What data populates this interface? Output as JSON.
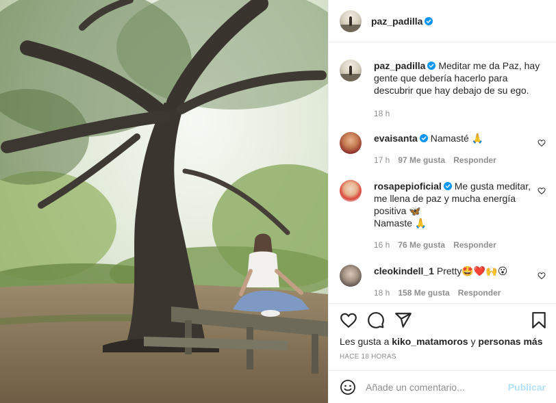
{
  "post": {
    "author": "paz_padilla",
    "caption": "Meditar me da Paz, hay gente que debería hacerlo para descubrir que hay debajo de su ego.",
    "caption_time": "18 h"
  },
  "comments": [
    {
      "user": "evaisanta",
      "verified": true,
      "text": "Namasté 🙏",
      "time": "17 h",
      "likes": "97 Me gusta",
      "reply": "Responder"
    },
    {
      "user": "rosapepioficial",
      "verified": true,
      "text": "Me gusta meditar, me llena de paz y mucha energía positiva 🦋",
      "text2": "Namaste 🙏",
      "time": "16 h",
      "likes": "76 Me gusta",
      "reply": "Responder"
    },
    {
      "user": "cleokindell_1",
      "verified": false,
      "text": "Pretty🤩❤️🙌😮",
      "time": "18 h",
      "likes": "158 Me gusta",
      "reply": "Responder"
    }
  ],
  "likes_line": {
    "prefix": "Les gusta a",
    "user": "kiko_matamoros",
    "connector": "y",
    "others": "personas más"
  },
  "posted": "HACE 18 HORAS",
  "comment_box": {
    "placeholder": "Añade un comentario...",
    "button": "Publicar"
  },
  "colors": {
    "verified": "#0095f6",
    "publish_disabled": "#b2dffc",
    "meta": "#8e8e8e",
    "border": "#efefef"
  },
  "icons": [
    "heart-icon",
    "comment-icon",
    "share-icon",
    "bookmark-icon",
    "emoji-icon",
    "verified-badge-icon"
  ]
}
